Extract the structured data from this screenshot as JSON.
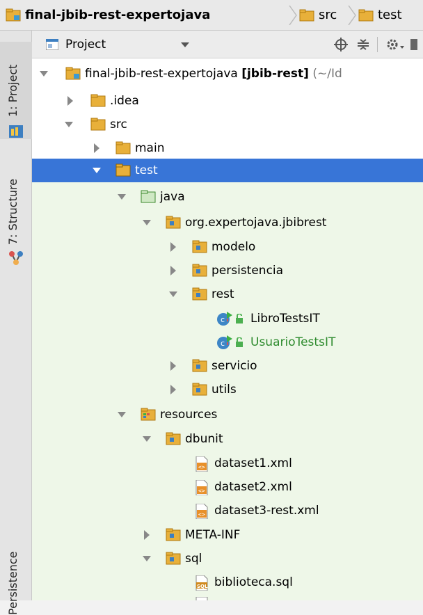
{
  "breadcrumb": {
    "items": [
      {
        "label": "final-jbib-rest-expertojava"
      },
      {
        "label": "src"
      },
      {
        "label": "test"
      }
    ]
  },
  "side_strip": {
    "tabs": [
      {
        "label": "1: Project"
      },
      {
        "label": "7: Structure"
      },
      {
        "label": "Persistence"
      }
    ]
  },
  "panel": {
    "view_selector": "Project"
  },
  "tree": {
    "root_name": "final-jbib-rest-expertojava",
    "root_module": "[jbib-rest]",
    "root_path": "(~/Id",
    "nodes": [
      {
        "label": "idea",
        "prefix": "."
      },
      {
        "label": "src"
      },
      {
        "label": "main"
      },
      {
        "label": "test"
      },
      {
        "label": "java"
      },
      {
        "label": "org.expertojava.jbibrest"
      },
      {
        "label": "modelo"
      },
      {
        "label": "persistencia"
      },
      {
        "label": "rest"
      },
      {
        "label": "LibroTestsIT"
      },
      {
        "label": "UsuarioTestsIT"
      },
      {
        "label": "servicio"
      },
      {
        "label": "utils"
      },
      {
        "label": "resources"
      },
      {
        "label": "dbunit"
      },
      {
        "label": "dataset1.xml"
      },
      {
        "label": "dataset2.xml"
      },
      {
        "label": "dataset3-rest.xml"
      },
      {
        "label": "META-INF"
      },
      {
        "label": "sql"
      },
      {
        "label": "biblioteca.sql"
      }
    ]
  },
  "colors": {
    "selection": "#3875d7",
    "test_background": "#eef7e8",
    "test_text": "#2e8b2e",
    "folder": "#e8b03a",
    "module_folder": "#3d9ad1"
  }
}
